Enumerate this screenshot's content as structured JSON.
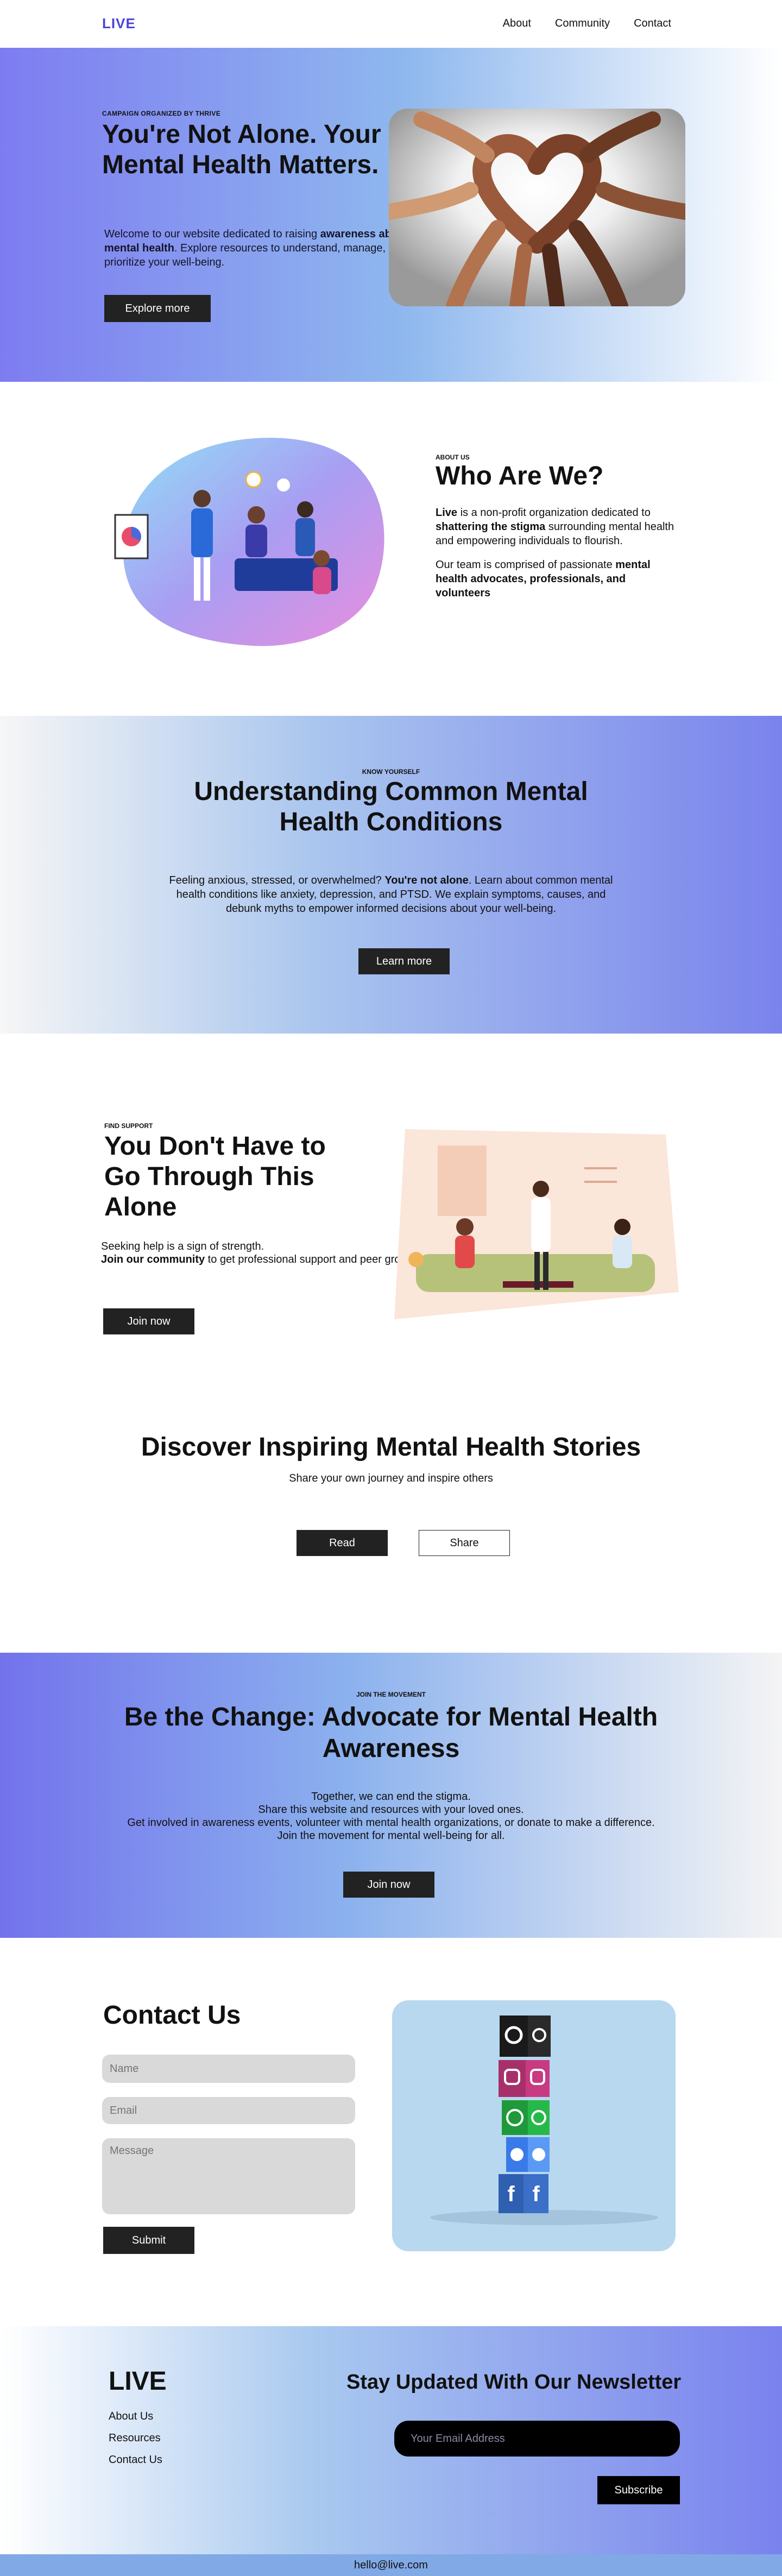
{
  "nav": {
    "logo": "LIVE",
    "links": [
      "About",
      "Community",
      "Contact"
    ]
  },
  "hero": {
    "tag": "CAMPAIGN ORGANIZED BY THRIVE",
    "title": "You're Not Alone. Your Mental Health Matters.",
    "text_1": "Welcome to our website dedicated to raising ",
    "text_bold": "awareness about mental health",
    "text_2": ". Explore resources to understand, manage, and prioritize your well-being.",
    "button": "Explore more"
  },
  "who": {
    "tag": "ABOUT US",
    "title": "Who Are We?",
    "p1_bold_1": "Live",
    "p1_text_1": " is a non-profit organization dedicated to ",
    "p1_bold_2": "shattering the stigma",
    "p1_text_2": " surrounding mental health and empowering individuals to flourish.",
    "p2_text": "Our team is comprised of passionate ",
    "p2_bold": "mental health advocates, professionals, and volunteers"
  },
  "understand": {
    "tag": "KNOW YOURSELF",
    "title": "Understanding Common Mental Health Conditions",
    "text_1": "Feeling anxious, stressed, or overwhelmed? ",
    "text_bold": "You're not alone",
    "text_2": ". Learn about common mental health conditions like anxiety, depression, and PTSD. We explain symptoms, causes, and debunk myths to empower informed decisions about your well-being.",
    "button": "Learn more"
  },
  "alone": {
    "tag": "FIND SUPPORT",
    "title": "You Don't Have to Go Through This Alone",
    "text_1": "Seeking help is a sign of strength.",
    "text_bold": "Join our community",
    "text_2": " to get professional support and peer groups.",
    "button": "Join now"
  },
  "stories": {
    "title": "Discover Inspiring Mental Health Stories",
    "subtitle": "Share your own journey and inspire others",
    "read": "Read",
    "share": "Share"
  },
  "change": {
    "tag": "JOIN THE MOVEMENT",
    "title": "Be the Change: Advocate for Mental Health Awareness",
    "line_1": "Together, we can end the stigma.",
    "line_2": "Share this website and resources with your loved ones.",
    "line_3": "Get involved in awareness events, volunteer with mental health organizations, or donate to make a difference. Join the movement for mental well-being for all.",
    "button": "Join now"
  },
  "contact": {
    "title": "Contact Us",
    "name_placeholder": "Name",
    "email_placeholder": "Email",
    "message_placeholder": "Message",
    "button": "Submit"
  },
  "footer": {
    "logo": "LIVE",
    "links": [
      "About Us",
      "Resources",
      "Contact Us"
    ],
    "newsletter_title": "Stay Updated With Our Newsletter",
    "email_placeholder": "Your Email Address",
    "subscribe": "Subscribe",
    "email": "hello@live.com"
  },
  "colors": {
    "brand": "#4a45d8",
    "gradient_purple": "#7e7cf1",
    "gradient_blue": "#8fb8ee",
    "button_dark": "#222222"
  }
}
